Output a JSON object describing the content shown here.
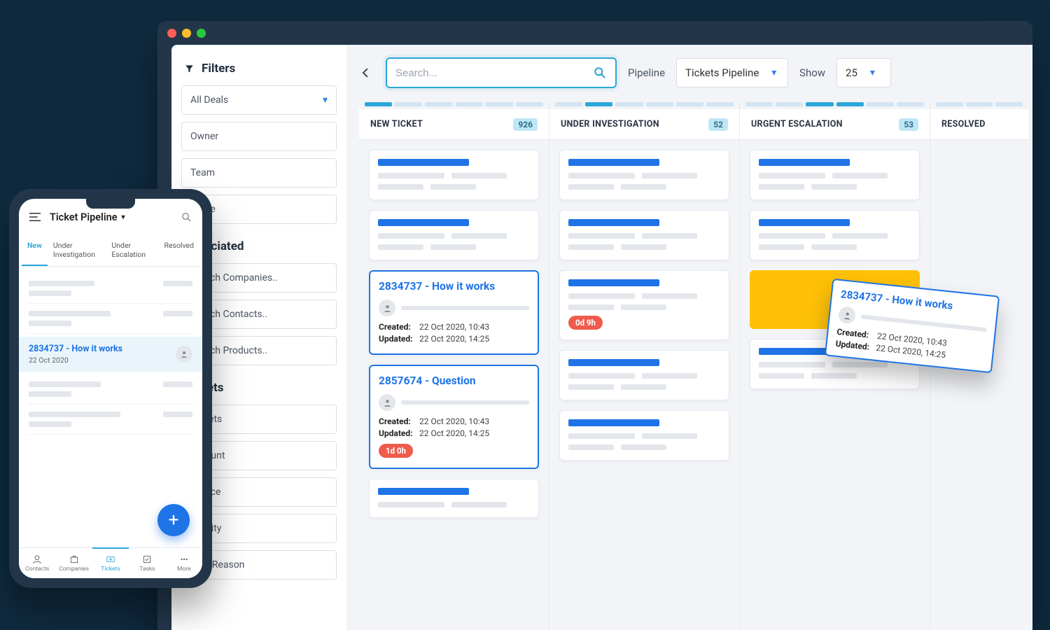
{
  "sidebar": {
    "filters_label": "Filters",
    "all_deals": "All Deals",
    "fields": [
      "Owner",
      "Team",
      "Stage"
    ],
    "associated_label": "Associated",
    "associated": [
      "Search Companies..",
      "Search Contacts..",
      "Search Products.."
    ],
    "tickets_label": "Tickets",
    "ticket_fields": [
      "Tickets",
      "Amount",
      "Source",
      "Priority",
      "Lost Reason"
    ]
  },
  "toolbar": {
    "search_placeholder": "Search...",
    "pipeline_label": "Pipeline",
    "pipeline_value": "Tickets Pipeline",
    "show_label": "Show",
    "show_value": "25"
  },
  "columns": [
    {
      "name": "NEW TICKET",
      "count": "926"
    },
    {
      "name": "UNDER INVESTIGATION",
      "count": "52"
    },
    {
      "name": "URGENT ESCALATION",
      "count": "53"
    },
    {
      "name": "RESOLVED",
      "count": ""
    }
  ],
  "tickets": {
    "a": {
      "title": "2834737 - How it works",
      "created_k": "Created:",
      "created_v": "22 Oct 2020, 10:43",
      "updated_k": "Updated:",
      "updated_v": "22 Oct 2020, 14:25"
    },
    "b": {
      "title": "2857674 - Question",
      "created_k": "Created:",
      "created_v": "22 Oct 2020, 10:43",
      "updated_k": "Updated:",
      "updated_v": "22 Oct 2020, 14:25",
      "chip": "1d 0h"
    },
    "chip_investigation": "0d 9h",
    "dragged": {
      "title": "2834737 - How it works",
      "created_k": "Created:",
      "created_v": "22 Oct 2020, 10:43",
      "updated_k": "Updated:",
      "updated_v": "22 Oct 2020, 14:25"
    }
  },
  "mobile": {
    "title": "Ticket Pipeline",
    "tabs": [
      "New",
      "Under Investigation",
      "Under Escalation",
      "Resolved"
    ],
    "selected": {
      "title": "2834737 - How it works",
      "date": "22 Oct 2020"
    },
    "nav": [
      "Contacts",
      "Companies",
      "Tickets",
      "Tasks",
      "More"
    ]
  }
}
